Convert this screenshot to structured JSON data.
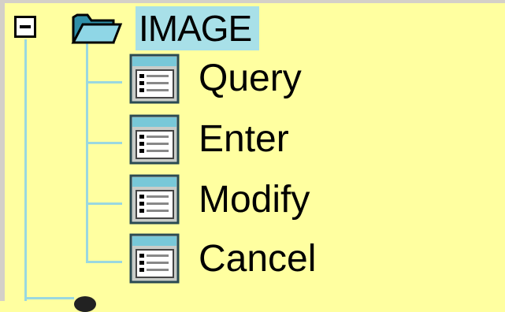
{
  "tree": {
    "root": {
      "label": "IMAGE",
      "icon": "open-folder-icon",
      "expanded": true
    },
    "children": [
      {
        "label": "Query",
        "icon": "form-window-icon"
      },
      {
        "label": "Enter",
        "icon": "form-window-icon"
      },
      {
        "label": "Modify",
        "icon": "form-window-icon"
      },
      {
        "label": "Cancel",
        "icon": "form-window-icon"
      }
    ]
  },
  "colors": {
    "background": "#ffffa0",
    "selection": "#a8e0e8",
    "tree_line": "#9ad8e0",
    "frame": "#d4d0c8"
  }
}
